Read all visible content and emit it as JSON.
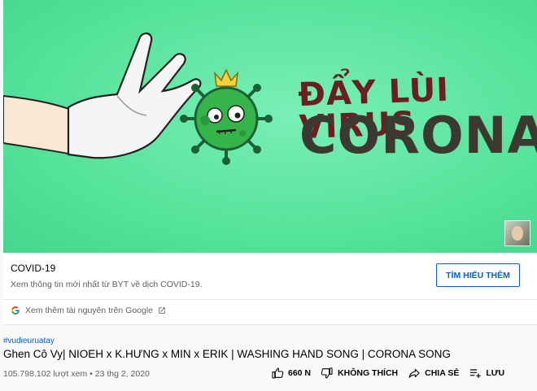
{
  "hero": {
    "line1": "ĐẨY LÙI VIRUS",
    "line2": "CORONA"
  },
  "covid": {
    "title": "COVID-19",
    "description": "Xem thông tin mới nhất từ BYT về dịch COVID-19.",
    "learn_more": "TÌM HIỂU THÊM",
    "more_resources": "Xem thêm tài nguyên trên Google"
  },
  "video": {
    "hashtag": "#vudieuruatay",
    "title": "Ghen Cô Vy| NIOEH x K.HƯNG x MIN x ERIK | WASHING HAND SONG | CORONA SONG",
    "meta": "105.798.102 lượt xem • 23 thg 2, 2020"
  },
  "actions": {
    "like": "660 N",
    "dislike": "KHÔNG THÍCH",
    "share": "CHIA SẺ",
    "save": "LƯU"
  },
  "colors": {
    "accent": "#065fd4",
    "hero_bg": "#5ce6a0"
  }
}
